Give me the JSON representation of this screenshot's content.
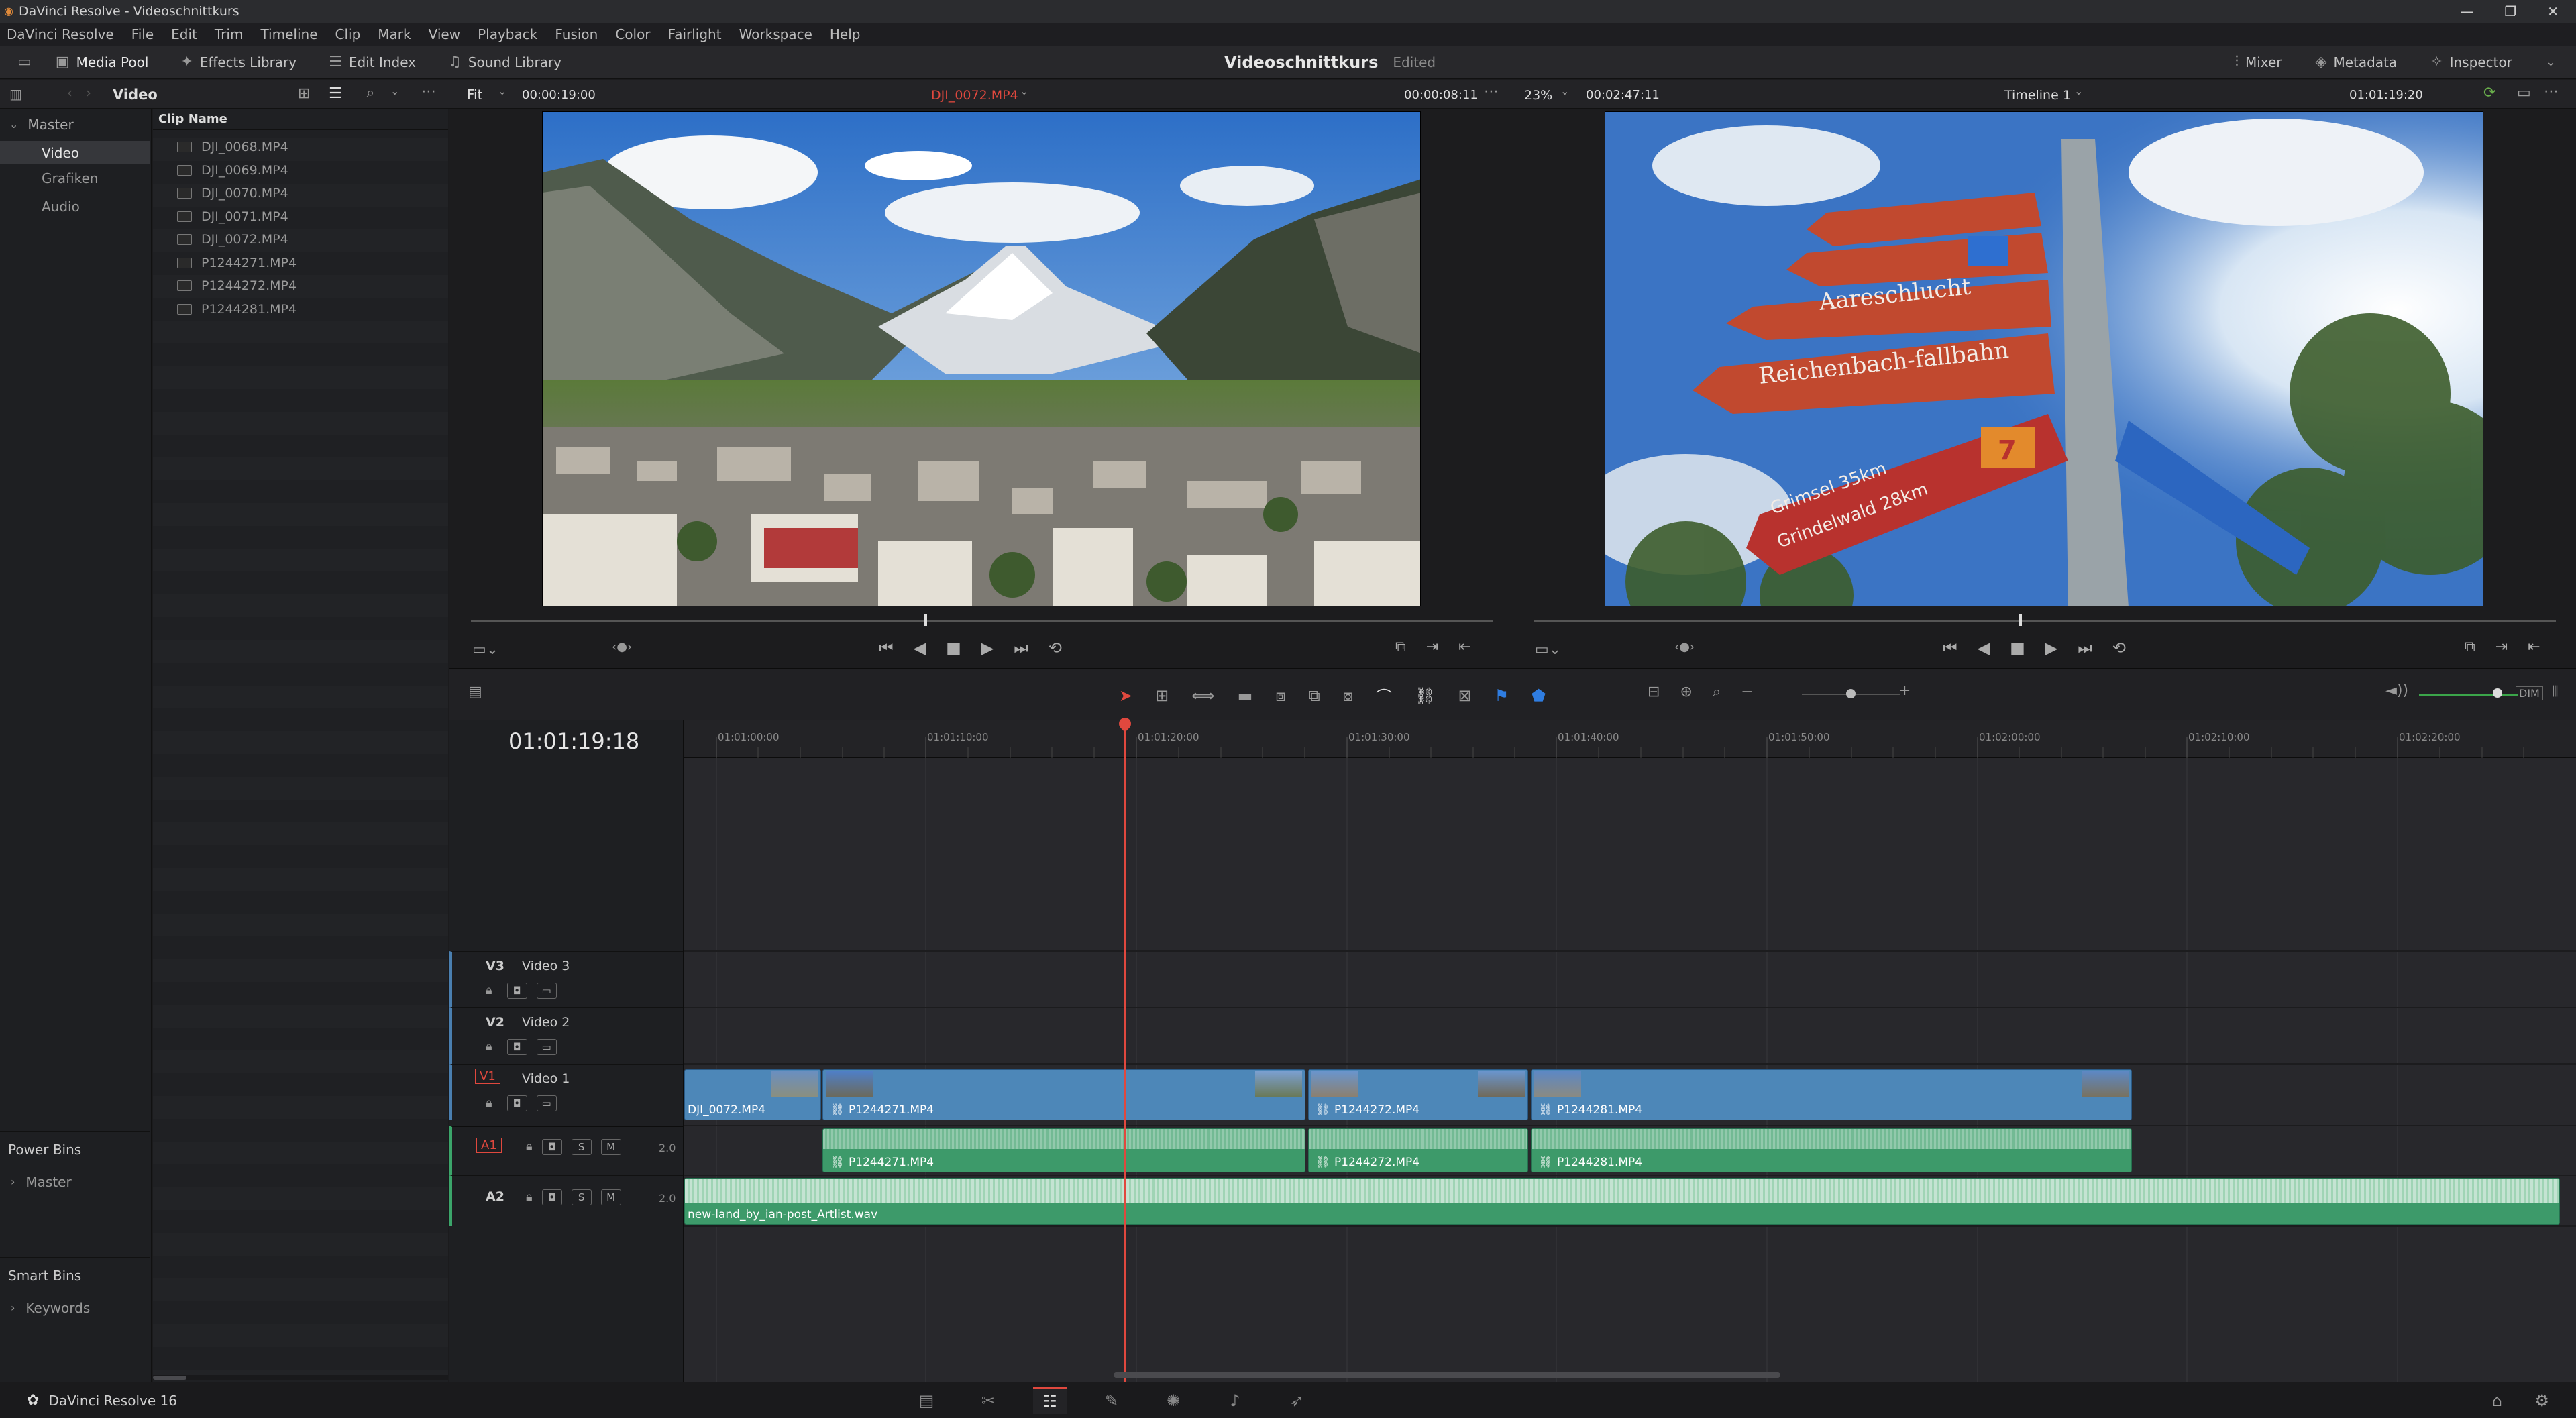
{
  "window": {
    "title": "DaVinci Resolve - Videoschnittkurs"
  },
  "menu": [
    "DaVinci Resolve",
    "File",
    "Edit",
    "Trim",
    "Timeline",
    "Clip",
    "Mark",
    "View",
    "Playback",
    "Fusion",
    "Color",
    "Fairlight",
    "Workspace",
    "Help"
  ],
  "toolbar": {
    "media_pool": "Media Pool",
    "effects_library": "Effects Library",
    "edit_index": "Edit Index",
    "sound_library": "Sound Library",
    "project_name": "Videoschnittkurs",
    "project_status": "Edited",
    "mixer": "Mixer",
    "metadata": "Metadata",
    "inspector": "Inspector"
  },
  "pool": {
    "bin_title": "Video",
    "column_header": "Clip Name",
    "clips": [
      "DJI_0068.MP4",
      "DJI_0069.MP4",
      "DJI_0070.MP4",
      "DJI_0071.MP4",
      "DJI_0072.MP4",
      "P1244271.MP4",
      "P1244272.MP4",
      "P1244281.MP4"
    ]
  },
  "sidebar": {
    "master": "Master",
    "bins": [
      "Video",
      "Grafiken",
      "Audio"
    ],
    "power_bins_title": "Power Bins",
    "power_bins_master": "Master",
    "smart_bins_title": "Smart Bins",
    "smart_bins_keywords": "Keywords"
  },
  "source_viewer": {
    "zoom": "Fit",
    "duration": "00:00:19:00",
    "clip_name": "DJI_0072.MP4",
    "timecode": "00:00:08:11"
  },
  "timeline_viewer": {
    "zoom": "23%",
    "duration": "00:02:47:11",
    "timeline_name": "Timeline 1",
    "timecode": "01:01:19:20"
  },
  "viewer_content": {
    "sign_texts": [
      "Aareschlucht",
      "Reichenbach-fallbahn",
      "Grimsel 35km",
      "Grindelwald 28km",
      "7"
    ]
  },
  "timeline": {
    "current_timecode": "01:01:19:18",
    "ruler": [
      "01:01:00:00",
      "01:01:10:00",
      "01:01:20:00",
      "01:01:30:00",
      "01:01:40:00",
      "01:01:50:00",
      "01:02:00:00",
      "01:02:10:00",
      "01:02:20:00"
    ],
    "tracks": {
      "v3": {
        "id": "V3",
        "name": "Video 3"
      },
      "v2": {
        "id": "V2",
        "name": "Video 2"
      },
      "v1": {
        "id": "V1",
        "name": "Video 1"
      },
      "a1": {
        "id": "A1",
        "channels": "2.0"
      },
      "a2": {
        "id": "A2",
        "channels": "2.0"
      }
    },
    "solo_label": "S",
    "mute_label": "M",
    "video_clips": [
      "DJI_0072.MP4",
      "P1244271.MP4",
      "P1244272.MP4",
      "P1244281.MP4"
    ],
    "audio_clips_a1": [
      "P1244271.MP4",
      "P1244272.MP4",
      "P1244281.MP4"
    ],
    "audio_clip_a2": "new-land_by_ian-post_Artlist.wav",
    "dim_label": "DIM"
  },
  "status": {
    "app_name": "DaVinci Resolve 16"
  }
}
